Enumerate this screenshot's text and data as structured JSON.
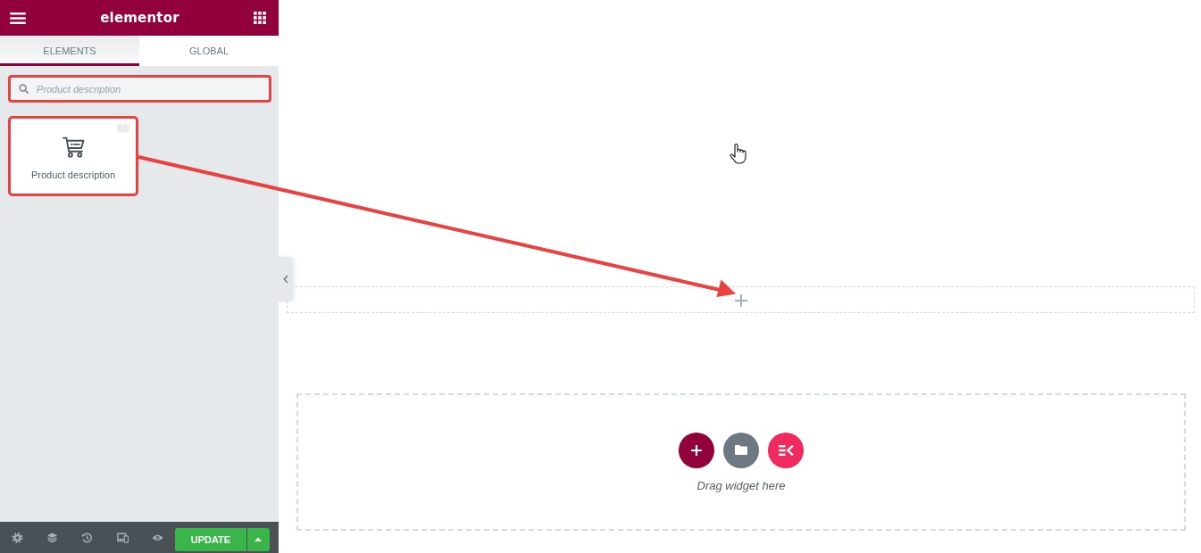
{
  "header": {
    "logo": "elementor"
  },
  "tabs": [
    {
      "label": "ELEMENTS",
      "selected": true
    },
    {
      "label": "GLOBAL",
      "selected": false
    }
  ],
  "search": {
    "value": "Product description",
    "highlighted": true
  },
  "widgets": [
    {
      "label": "Product description",
      "highlighted": true
    }
  ],
  "footer": {
    "update_button": "UPDATE"
  },
  "canvas": {
    "empty_section": {
      "hint": "Drag widget here"
    }
  }
}
